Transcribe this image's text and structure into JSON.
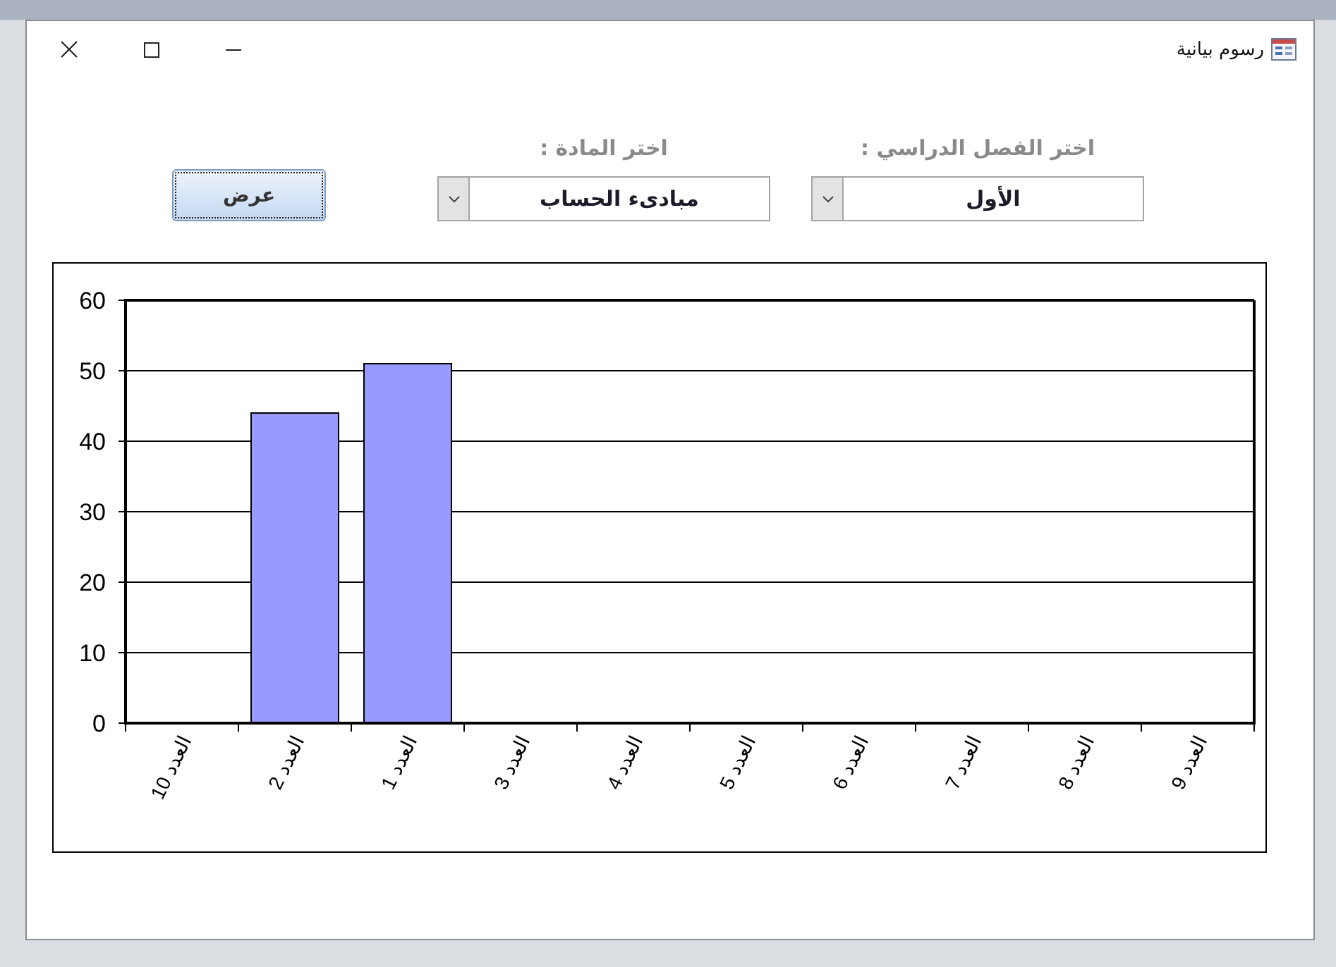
{
  "window": {
    "title": "رسوم بيانية"
  },
  "filters": [
    {
      "label": "اختر الفصل الدراسي :",
      "value": "الأول"
    },
    {
      "label": "اختر المادة :",
      "value": "مبادىء الحساب"
    }
  ],
  "show_button": {
    "label": "عرض",
    "focused": true
  },
  "chart": {
    "chart_data": {
      "type": "bar",
      "categories": [
        "العدد 10",
        "العدد 2",
        "العدد 1",
        "العدد 3",
        "العدد 4",
        "العدد 5",
        "العدد 6",
        "العدد 7",
        "العدد 8",
        "العدد 9"
      ],
      "values": [
        null,
        44,
        51,
        null,
        null,
        null,
        null,
        null,
        null,
        null
      ],
      "ylim": [
        0,
        60
      ],
      "yticks": [
        0,
        10,
        20,
        30,
        40,
        50,
        60
      ],
      "grid": true
    }
  }
}
